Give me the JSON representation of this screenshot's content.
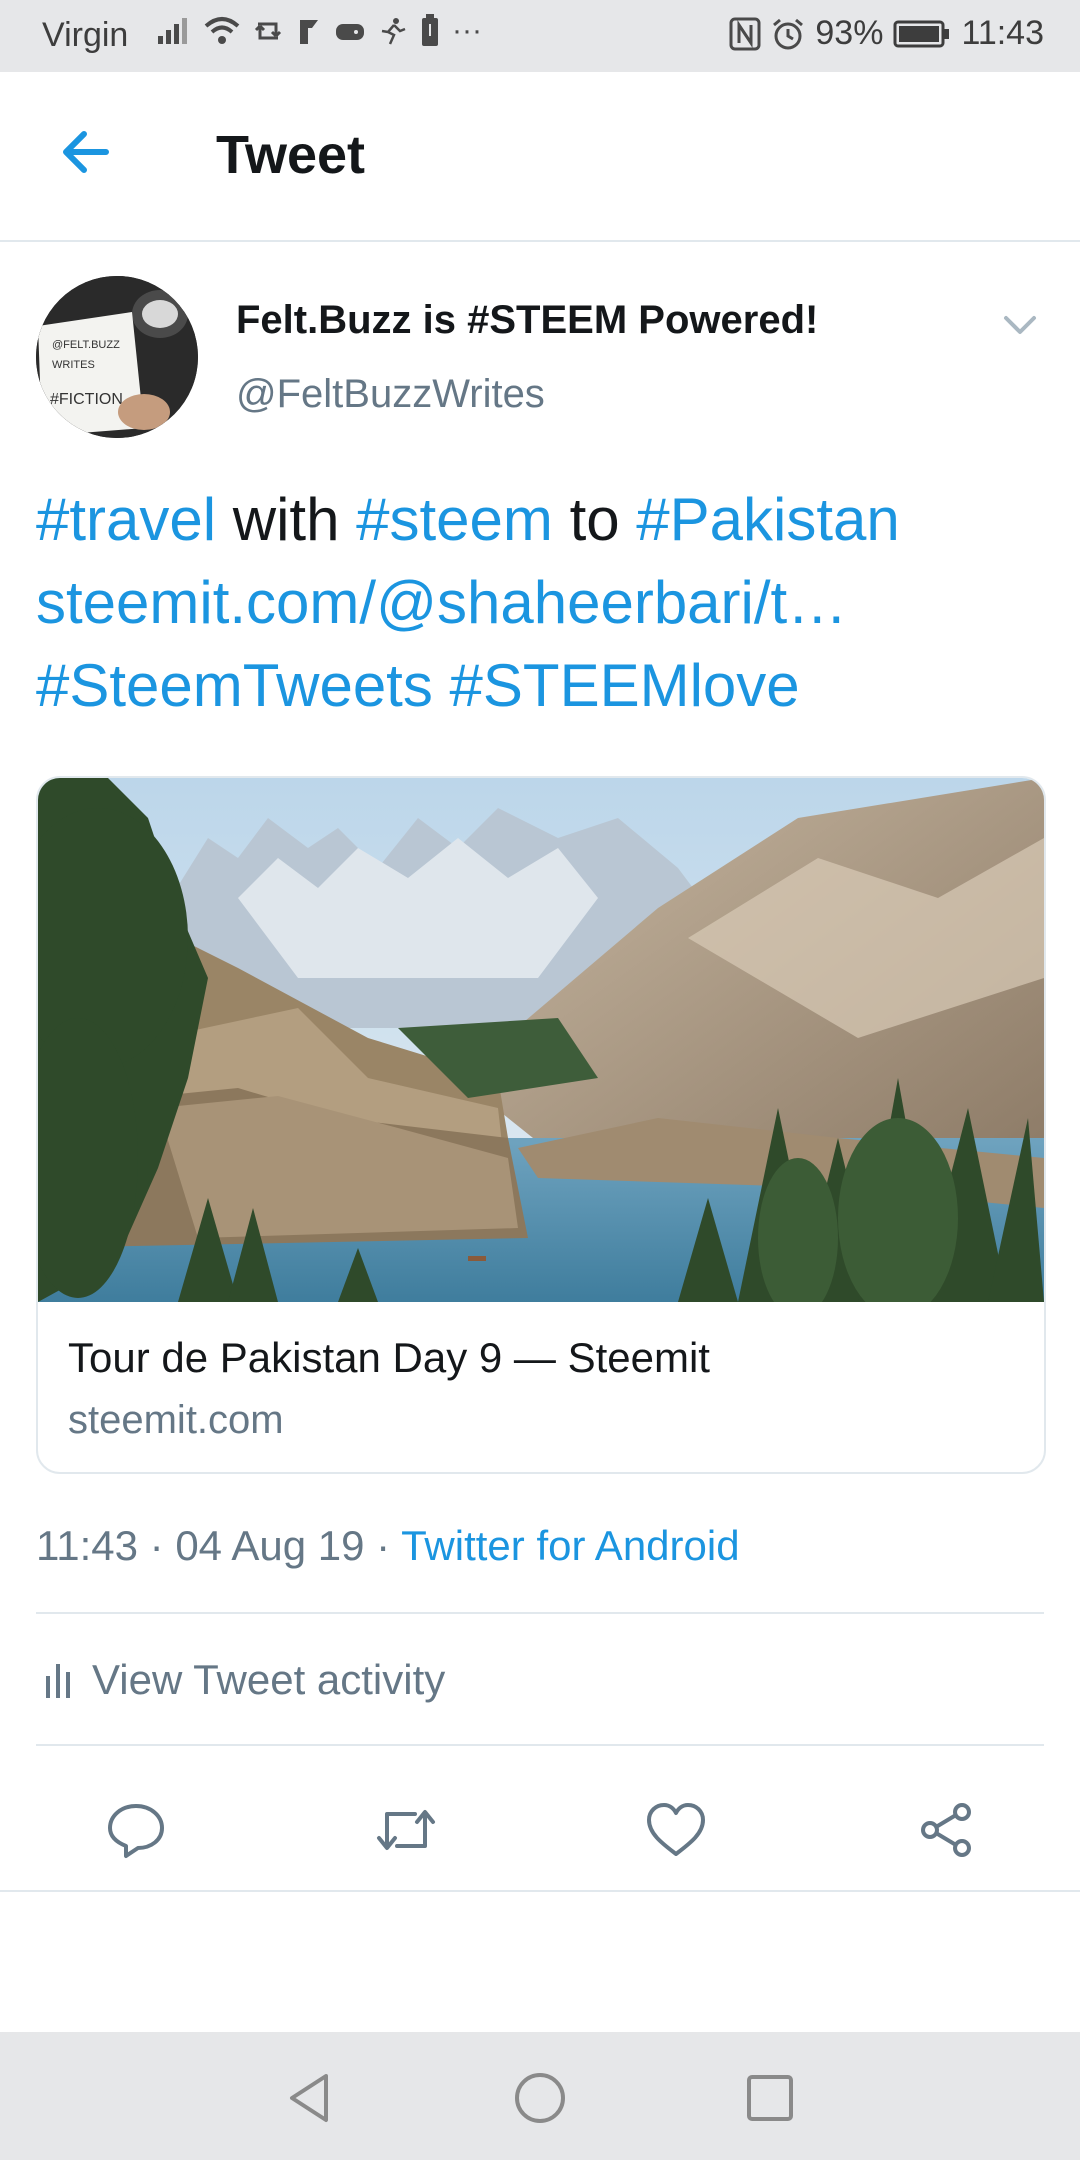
{
  "status_bar": {
    "carrier": "Virgin",
    "battery_percent": "93%",
    "time": "11:43",
    "more_indicator": "···",
    "icons": [
      "signal-icon",
      "wifi-icon",
      "retweet-notification-icon",
      "flipboard-icon",
      "game-icon",
      "running-icon",
      "battery-saver-icon",
      "nfc-icon",
      "alarm-icon",
      "battery-icon"
    ]
  },
  "app_bar": {
    "title": "Tweet",
    "back_icon": "arrow-left-icon"
  },
  "author": {
    "display_name": "Felt.Buzz is #STEEM Powered!",
    "handle": "@FeltBuzzWrites",
    "avatar_text": [
      "@FELT.BUZZ",
      "WRITES",
      "#FICTION"
    ]
  },
  "tweet": {
    "segments": [
      {
        "text": "#travel",
        "link": true
      },
      {
        "text": " with ",
        "link": false
      },
      {
        "text": "#steem",
        "link": true
      },
      {
        "text": " to ",
        "link": false
      },
      {
        "text": "#Pakistan",
        "link": true
      },
      {
        "text": " steemit.com/@shaheerbari/t…",
        "link": true
      },
      {
        "text": " #SteemTweets",
        "link": true
      },
      {
        "text": " #STEEMlove",
        "link": true
      }
    ]
  },
  "card": {
    "title": "Tour de Pakistan Day 9 — Steemit",
    "domain": "steemit.com"
  },
  "meta": {
    "time": "11:43",
    "date": "04 Aug 19",
    "separator": " · ",
    "source": "Twitter for Android"
  },
  "activity": {
    "label": "View Tweet activity"
  },
  "actions": [
    "reply-icon",
    "retweet-icon",
    "like-icon",
    "share-icon"
  ],
  "colors": {
    "accent": "#1b95e0",
    "text": "#14171a",
    "secondary": "#657786",
    "divider": "#e1e8ed",
    "system_bar": "#e6e7e9"
  }
}
